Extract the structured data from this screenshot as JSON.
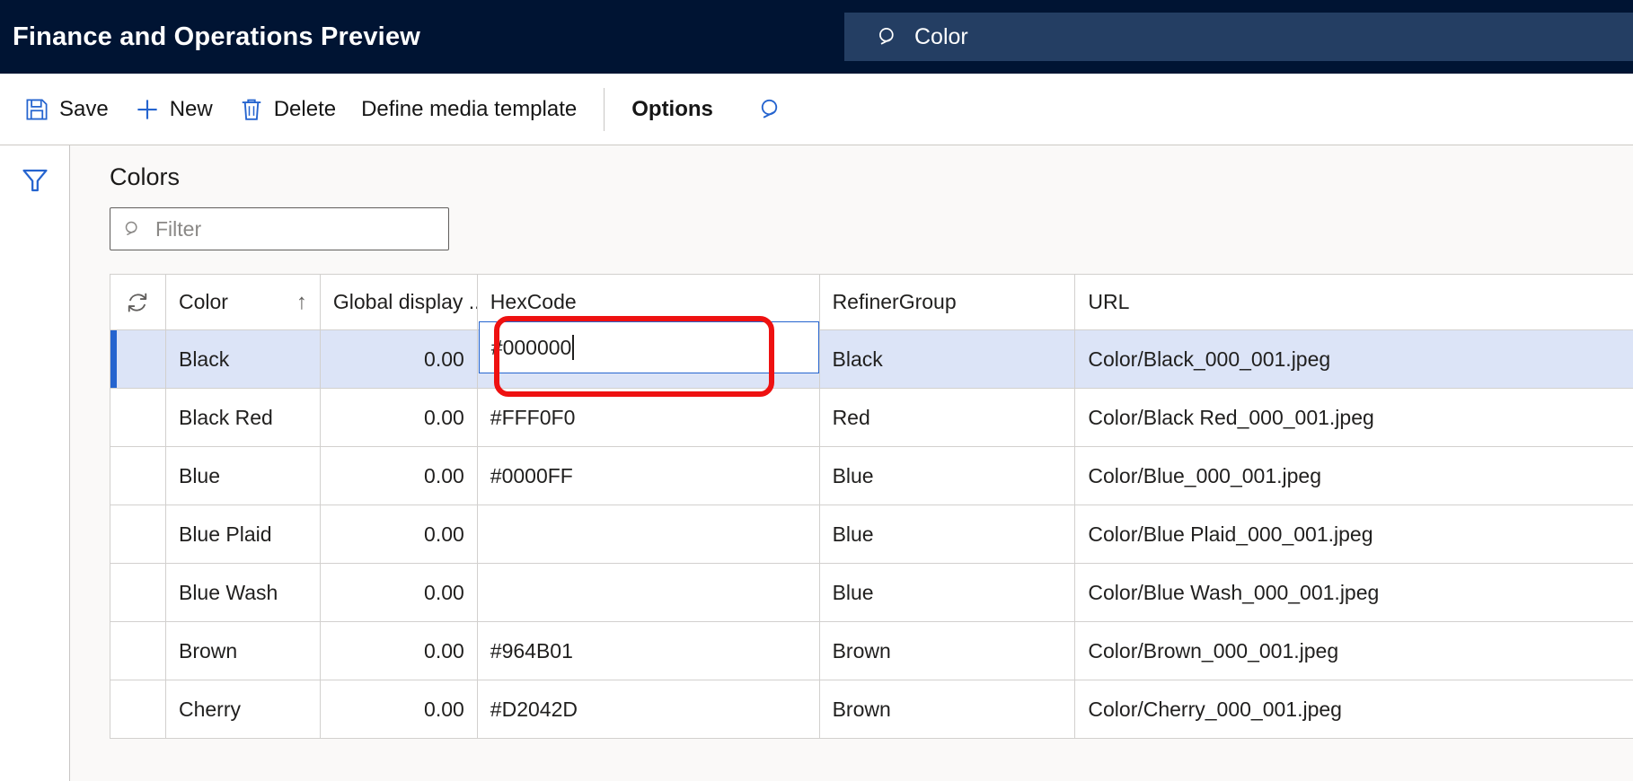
{
  "topbar": {
    "title": "Finance and Operations Preview",
    "search_value": "Color",
    "search_icon": "search-icon"
  },
  "toolbar": {
    "items": [
      {
        "label": "Save",
        "icon": "save-icon"
      },
      {
        "label": "New",
        "icon": "plus-icon"
      },
      {
        "label": "Delete",
        "icon": "trash-icon"
      },
      {
        "label": "Define media template",
        "icon": ""
      },
      {
        "label": "Options",
        "icon": ""
      }
    ],
    "search_icon": "search-icon"
  },
  "rail": {
    "filter_icon": "filter-funnel-icon"
  },
  "page": {
    "title": "Colors",
    "filter_placeholder": "Filter",
    "filter_value": "",
    "filter_icon": "search-icon"
  },
  "grid": {
    "refresh_icon": "refresh-icon",
    "sort_indicator": "↑",
    "columns": [
      "",
      "Color",
      "Global display ...",
      "HexCode",
      "RefinerGroup",
      "URL"
    ],
    "editing": {
      "column": "HexCode",
      "value": "#000000",
      "caret": true
    },
    "rows": [
      {
        "color": "Black",
        "global_display": "0.00",
        "hexcode": "#000000",
        "refiner_group": "Black",
        "url": "Color/Black_000_001.jpeg",
        "selected": true
      },
      {
        "color": "Black Red",
        "global_display": "0.00",
        "hexcode": "#FFF0F0",
        "refiner_group": "Red",
        "url": "Color/Black Red_000_001.jpeg",
        "selected": false
      },
      {
        "color": "Blue",
        "global_display": "0.00",
        "hexcode": "#0000FF",
        "refiner_group": "Blue",
        "url": "Color/Blue_000_001.jpeg",
        "selected": false
      },
      {
        "color": "Blue Plaid",
        "global_display": "0.00",
        "hexcode": "",
        "refiner_group": "Blue",
        "url": "Color/Blue Plaid_000_001.jpeg",
        "selected": false
      },
      {
        "color": "Blue Wash",
        "global_display": "0.00",
        "hexcode": "",
        "refiner_group": "Blue",
        "url": "Color/Blue Wash_000_001.jpeg",
        "selected": false
      },
      {
        "color": "Brown",
        "global_display": "0.00",
        "hexcode": "#964B01",
        "refiner_group": "Brown",
        "url": "Color/Brown_000_001.jpeg",
        "selected": false
      },
      {
        "color": "Cherry",
        "global_display": "0.00",
        "hexcode": "#D2042D",
        "refiner_group": "Brown",
        "url": "Color/Cherry_000_001.jpeg",
        "selected": false
      }
    ]
  },
  "colors": {
    "topbar_bg": "#001433",
    "topbar_search_bg": "#243e63",
    "accent_blue": "#2564cf",
    "selected_row_bg": "#dce4f7",
    "content_bg": "#faf9f8",
    "annotation_red": "#ee1111"
  }
}
